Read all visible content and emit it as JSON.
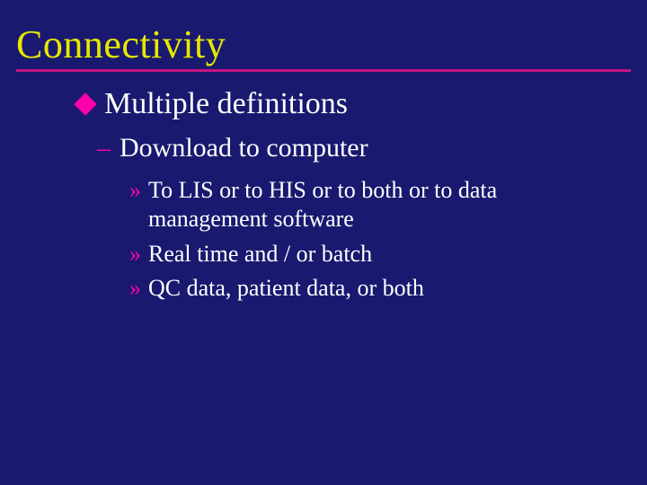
{
  "slide": {
    "title": "Connectivity",
    "bullet1": "Multiple definitions",
    "bullet2_dash": "–",
    "bullet2": "Download to computer",
    "chev": "»",
    "sub1": "To LIS or to HIS or to both or to data management software",
    "sub2": "Real time and / or batch",
    "sub3": "QC data, patient data, or both"
  }
}
